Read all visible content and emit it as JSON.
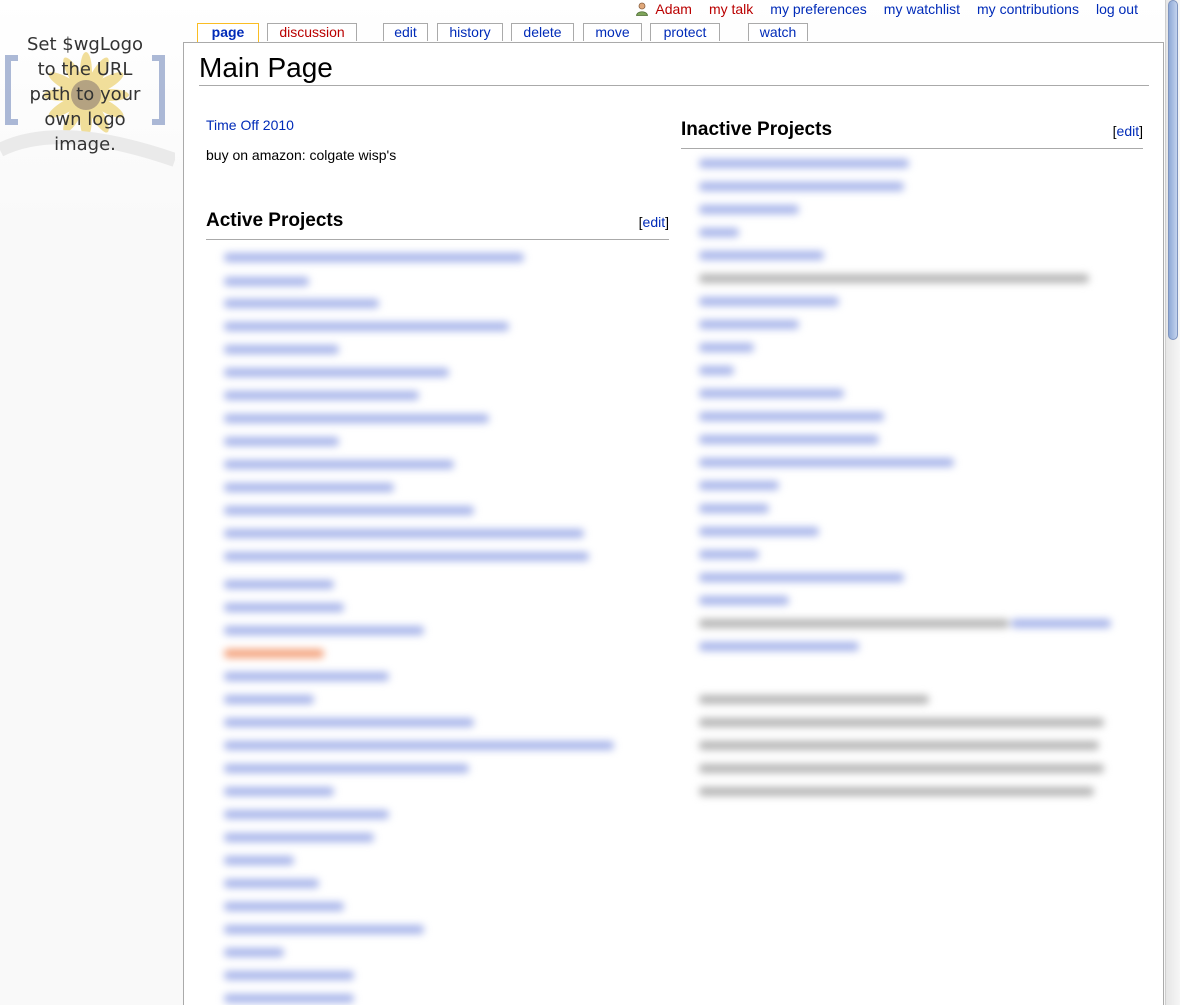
{
  "logo": {
    "text": "Set $wgLogo\nto the URL\npath to your\nown logo\nimage."
  },
  "personal_tools": {
    "username": "Adam",
    "my_talk": "my talk",
    "my_preferences": "my preferences",
    "my_watchlist": "my watchlist",
    "my_contributions": "my contributions",
    "log_out": "log out"
  },
  "tabs": {
    "page": "page",
    "discussion": "discussion",
    "edit": "edit",
    "history": "history",
    "delete": "delete",
    "move": "move",
    "protect": "protect",
    "watch": "watch"
  },
  "content": {
    "title": "Main Page",
    "time_off_link": "Time Off 2010",
    "note": "buy on amazon: colgate wisp's",
    "active_heading": "Active Projects",
    "inactive_heading": "Inactive Projects",
    "edit_open": "[",
    "edit_label": "edit",
    "edit_close": "]"
  },
  "colors": {
    "link": "#002bb8",
    "redlink": "#ba0000",
    "selected_tab_border": "#fabd23",
    "blurred_link": "#a8b5ea",
    "blurred_redlink": "#f4a37e",
    "blurred_text": "#b5b5b5"
  },
  "icons": {
    "user": "user-icon",
    "logo": "sunflower-logo-icon"
  }
}
